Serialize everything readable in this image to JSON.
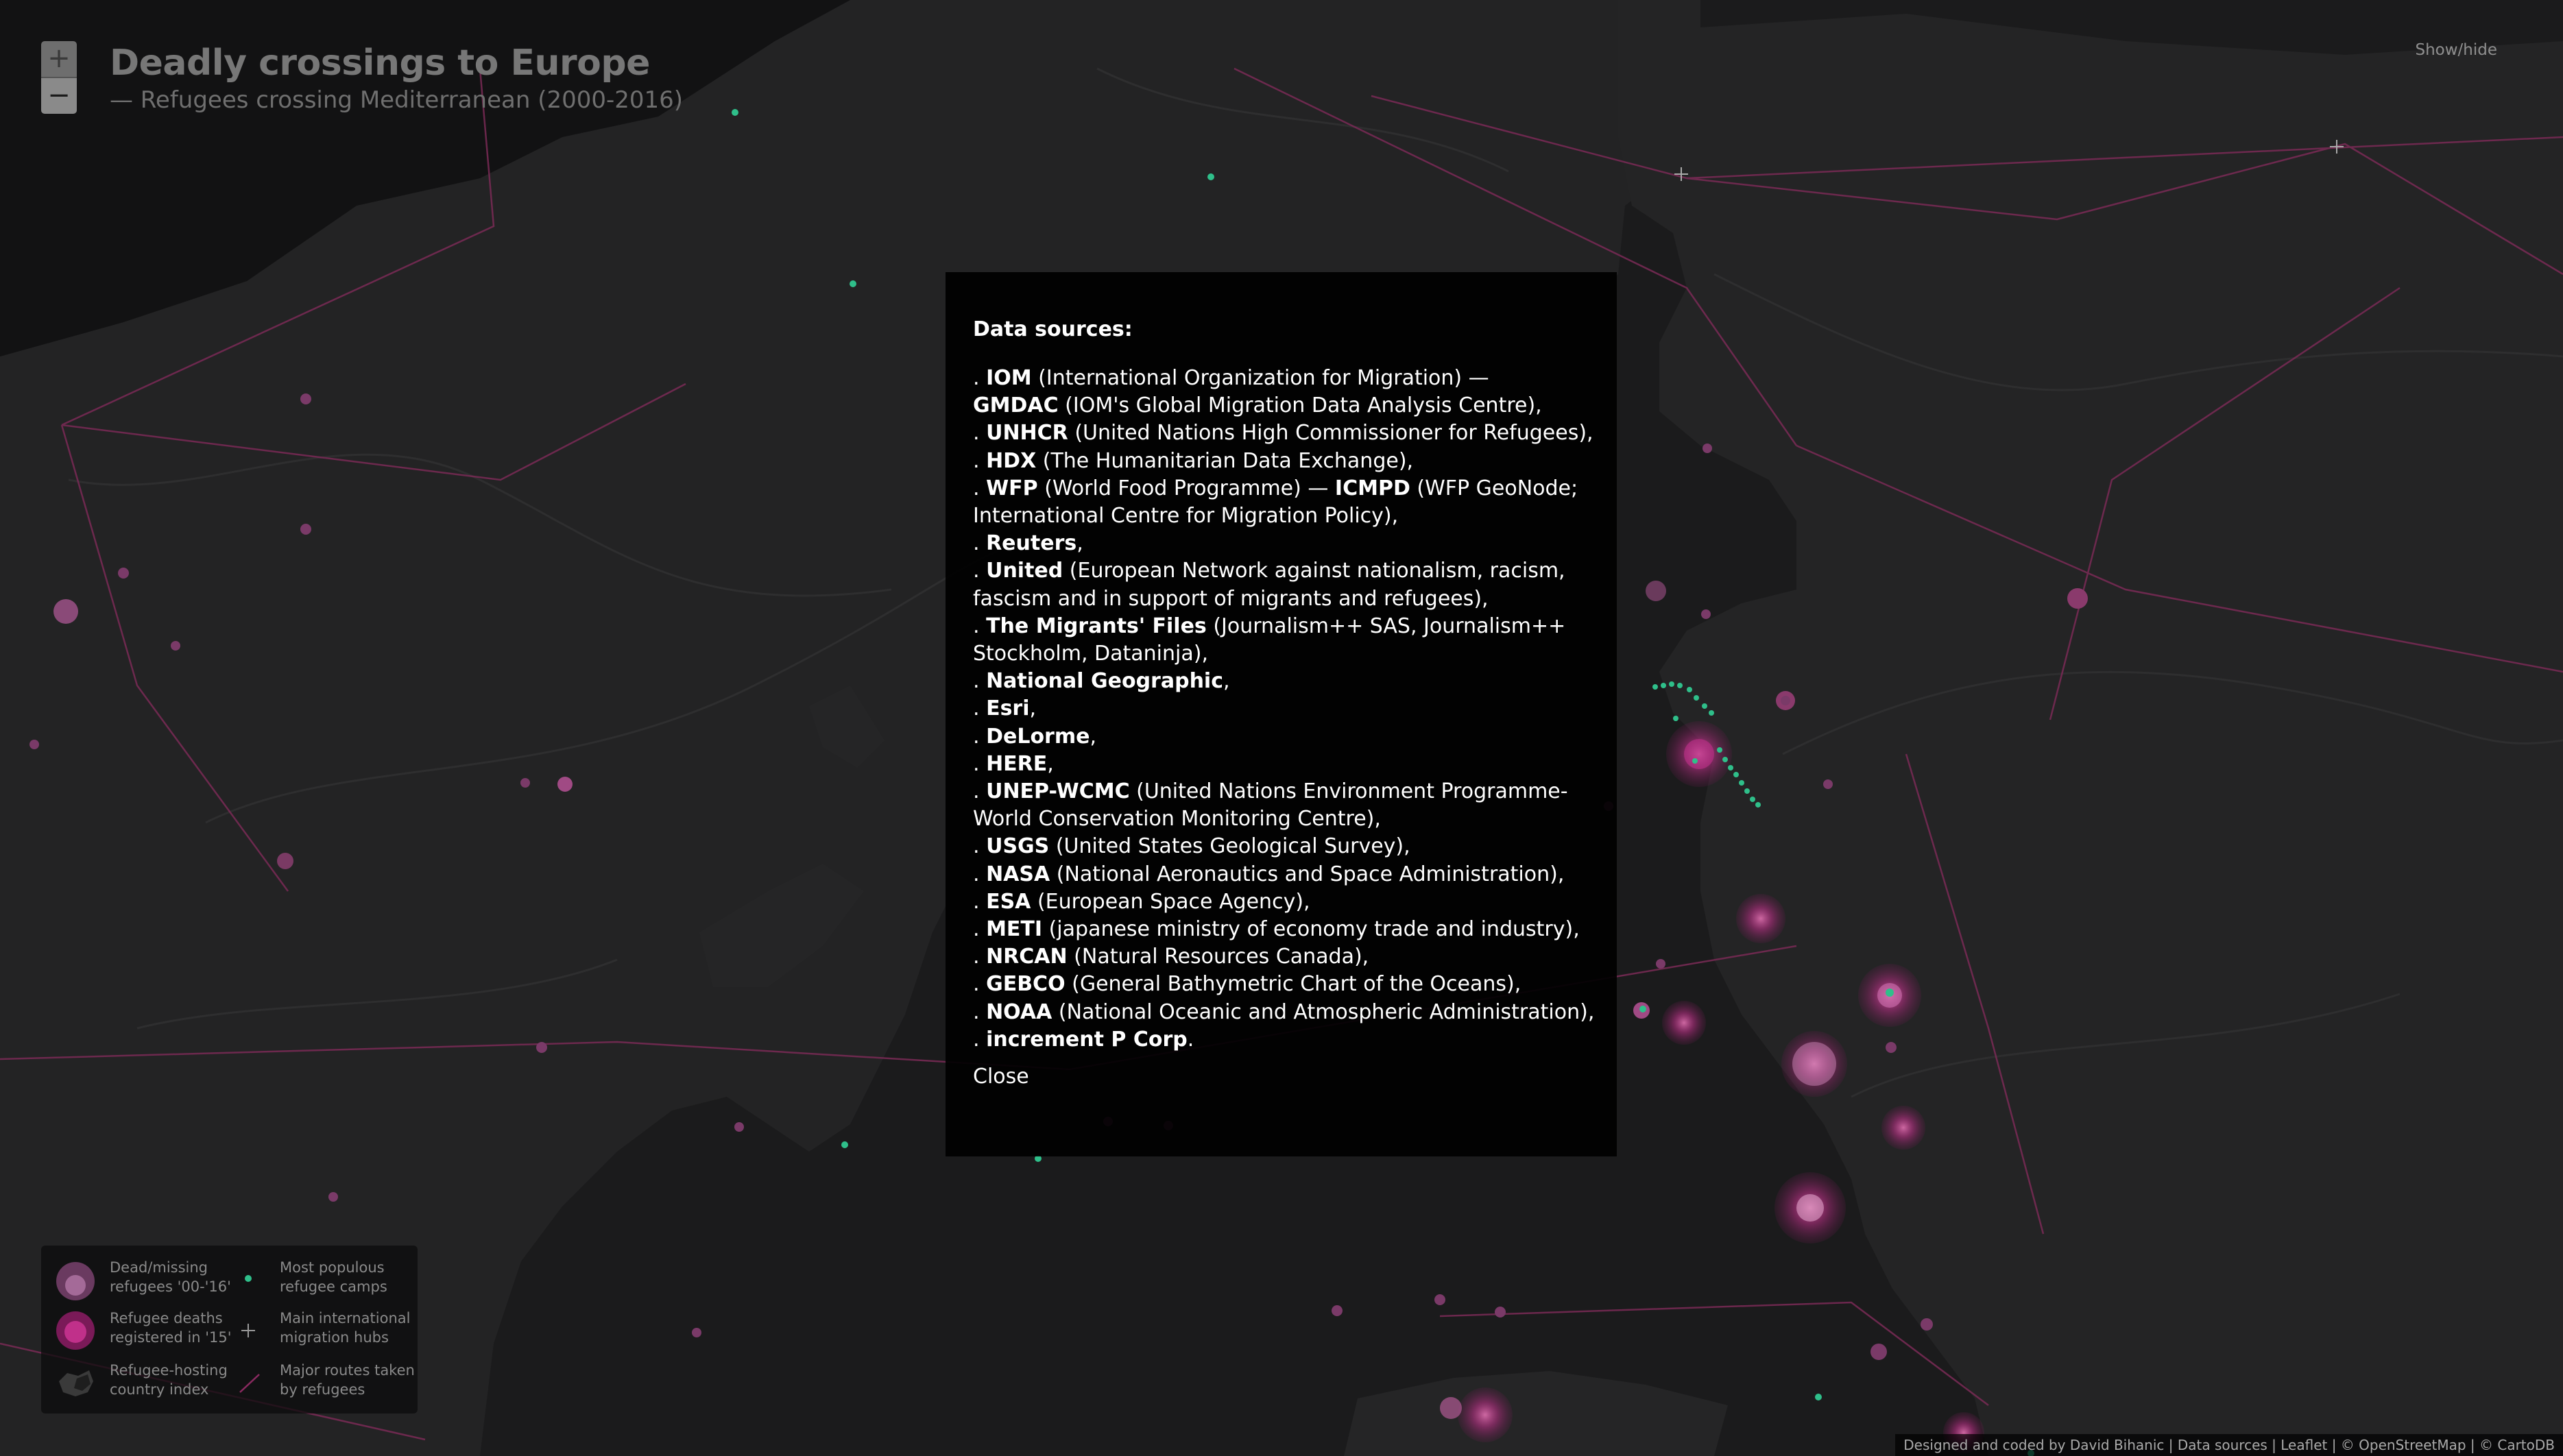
{
  "header": {
    "title": "Deadly crossings to Europe",
    "subtitle": "— Refugees crossing Mediterranean (2000-2016)",
    "show_hide": "Show/hide",
    "zoom_in": "+",
    "zoom_out": "−"
  },
  "modal": {
    "heading": "Data sources:",
    "items": [
      [
        {
          "b": "IOM"
        },
        {
          "t": " (International Organization for Migration) —"
        }
      ],
      [
        {
          "b": "GMDAC",
          "np": true
        },
        {
          "t": " (IOM's Global Migration Data Analysis Centre),"
        }
      ],
      [
        {
          "b": "UNHCR"
        },
        {
          "t": " (United Nations High Commissioner for Refugees),"
        }
      ],
      [
        {
          "b": "HDX"
        },
        {
          "t": " (The Humanitarian Data Exchange),"
        }
      ],
      [
        {
          "b": "WFP"
        },
        {
          "t": " (World Food Programme) — "
        },
        {
          "b2": "ICMPD"
        },
        {
          "t": " (WFP GeoNode;"
        }
      ],
      [
        {
          "t": "International Centre for Migration Policy),",
          "np": true
        }
      ],
      [
        {
          "b": "Reuters"
        },
        {
          "t": ","
        }
      ],
      [
        {
          "b": "United"
        },
        {
          "t": " (European Network against nationalism, racism,"
        }
      ],
      [
        {
          "t": "fascism and in support of migrants and refugees),",
          "np": true
        }
      ],
      [
        {
          "b": "The Migrants' Files"
        },
        {
          "t": " (Journalism++ SAS, Journalism++"
        }
      ],
      [
        {
          "t": "Stockholm, Dataninja),",
          "np": true
        }
      ],
      [
        {
          "b": "National Geographic"
        },
        {
          "t": ","
        }
      ],
      [
        {
          "b": "Esri"
        },
        {
          "t": ","
        }
      ],
      [
        {
          "b": "DeLorme"
        },
        {
          "t": ","
        }
      ],
      [
        {
          "b": "HERE"
        },
        {
          "t": ","
        }
      ],
      [
        {
          "b": "UNEP-WCMC"
        },
        {
          "t": " (United Nations Environment Programme-"
        }
      ],
      [
        {
          "t": "World Conservation Monitoring Centre),",
          "np": true
        }
      ],
      [
        {
          "b": "USGS"
        },
        {
          "t": " (United States Geological Survey),"
        }
      ],
      [
        {
          "b": "NASA"
        },
        {
          "t": " (National Aeronautics and Space Administration),"
        }
      ],
      [
        {
          "b": "ESA"
        },
        {
          "t": " (European Space Agency),"
        }
      ],
      [
        {
          "b": "METI"
        },
        {
          "t": " (japanese ministry of economy trade and industry),"
        }
      ],
      [
        {
          "b": "NRCAN"
        },
        {
          "t": " (Natural Resources Canada),"
        }
      ],
      [
        {
          "b": "GEBCO"
        },
        {
          "t": " (General Bathymetric Chart of the Oceans),"
        }
      ],
      [
        {
          "b": "NOAA"
        },
        {
          "t": " (National Oceanic and Atmospheric Administration),"
        }
      ],
      [
        {
          "b": "increment P Corp"
        },
        {
          "t": "."
        }
      ]
    ],
    "close_label": "Close"
  },
  "legend": {
    "dead_missing": [
      "Dead/missing",
      "refugees '00-'16'"
    ],
    "deaths_15": [
      "Refugee deaths",
      "registered in '15'"
    ],
    "hosting": [
      "Refugee-hosting",
      "country index"
    ],
    "camps": [
      "Most populous",
      "refugee camps"
    ],
    "hubs": [
      "Main international",
      "migration hubs"
    ],
    "routes": [
      "Major routes taken",
      "by refugees"
    ]
  },
  "attribution": "Designed and coded by David Bihanic | Data sources | Leaflet | © OpenStreetMap | © CartoDB",
  "colors": {
    "background": "#1b1b1c",
    "land": "#232324",
    "route": "#7a2a56",
    "death_circle": "#c0308a",
    "camp": "#2fbf8a"
  }
}
